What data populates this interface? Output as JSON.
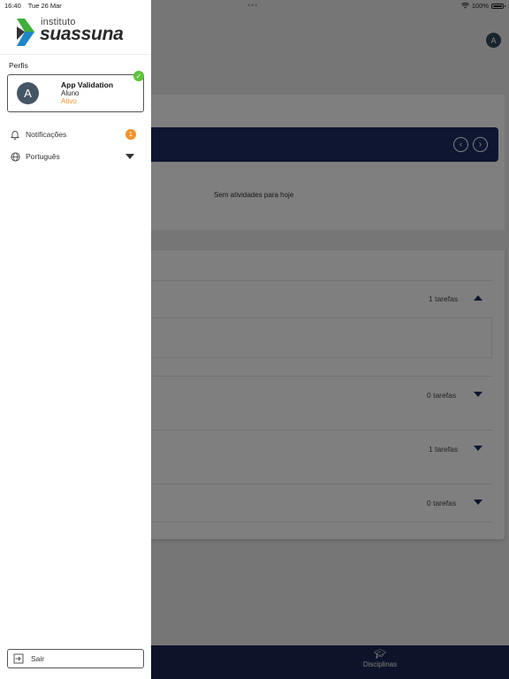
{
  "status_bar": {
    "time": "16:40",
    "date": "Tue 26 Mar",
    "battery": "100%"
  },
  "app": {
    "user_initial": "A",
    "empty_message": "Sem atividades para hoje",
    "task_groups": [
      {
        "count_label": "1 tarefas",
        "expanded": true
      },
      {
        "count_label": "0 tarefas",
        "expanded": false
      },
      {
        "count_label": "1 tarefas",
        "expanded": false
      },
      {
        "count_label": "0 tarefas",
        "expanded": false
      }
    ],
    "bottom_nav": {
      "disciplinas_label": "Disciplinas"
    }
  },
  "drawer": {
    "logo": {
      "small": "instituto",
      "big": "suassuna"
    },
    "profiles_label": "Perfis",
    "profile": {
      "initial": "A",
      "name": "App Validation",
      "role": "Aluno",
      "status": "Ativo"
    },
    "menu": {
      "notifications_label": "Notificações",
      "notifications_count": "1",
      "language_label": "Português"
    },
    "logout_label": "Sair"
  },
  "colors": {
    "navy": "#1c2d62",
    "accent_orange": "#f0932b",
    "active_green": "#5cc43b"
  }
}
